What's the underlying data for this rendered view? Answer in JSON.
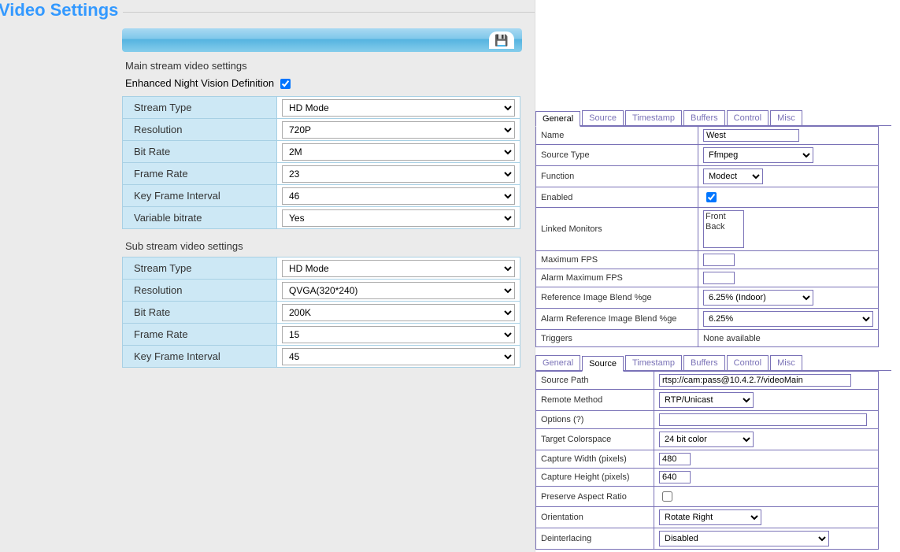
{
  "left": {
    "title": "Video Settings",
    "save_icon_name": "save-icon",
    "main_title": "Main stream video settings",
    "envd_label": "Enhanced Night Vision Definition",
    "envd_checked": true,
    "main_rows": [
      {
        "label": "Stream Type",
        "value": "HD Mode"
      },
      {
        "label": "Resolution",
        "value": "720P"
      },
      {
        "label": "Bit Rate",
        "value": "2M"
      },
      {
        "label": "Frame Rate",
        "value": "23"
      },
      {
        "label": "Key Frame Interval",
        "value": "46"
      },
      {
        "label": "Variable bitrate",
        "value": "Yes"
      }
    ],
    "sub_title": "Sub stream video settings",
    "sub_rows": [
      {
        "label": "Stream Type",
        "value": "HD Mode"
      },
      {
        "label": "Resolution",
        "value": "QVGA(320*240)"
      },
      {
        "label": "Bit Rate",
        "value": "200K"
      },
      {
        "label": "Frame Rate",
        "value": "15"
      },
      {
        "label": "Key Frame Interval",
        "value": "45"
      }
    ]
  },
  "zm": {
    "tabs": [
      "General",
      "Source",
      "Timestamp",
      "Buffers",
      "Control",
      "Misc"
    ],
    "general": {
      "active_tab": "General",
      "name_label": "Name",
      "name_value": "West",
      "source_type_label": "Source Type",
      "source_type_value": "Ffmpeg",
      "function_label": "Function",
      "function_value": "Modect",
      "enabled_label": "Enabled",
      "enabled_checked": true,
      "linked_label": "Linked Monitors",
      "linked_items": [
        "Front",
        "Back"
      ],
      "max_fps_label": "Maximum FPS",
      "max_fps_value": "",
      "alarm_max_fps_label": "Alarm Maximum FPS",
      "alarm_max_fps_value": "",
      "ref_blend_label": "Reference Image Blend %ge",
      "ref_blend_value": "6.25% (Indoor)",
      "alarm_ref_blend_label": "Alarm Reference Image Blend %ge",
      "alarm_ref_blend_value": "6.25%",
      "triggers_label": "Triggers",
      "triggers_value": "None available"
    },
    "source": {
      "active_tab": "Source",
      "path_label": "Source Path",
      "path_value": "rtsp://cam:pass@10.4.2.7/videoMain",
      "method_label": "Remote Method",
      "method_value": "RTP/Unicast",
      "options_label": "Options (?)",
      "options_value": "",
      "colorspace_label": "Target Colorspace",
      "colorspace_value": "24 bit color",
      "cap_w_label": "Capture Width (pixels)",
      "cap_w_value": "480",
      "cap_h_label": "Capture Height (pixels)",
      "cap_h_value": "640",
      "preserve_label": "Preserve Aspect Ratio",
      "preserve_checked": false,
      "orient_label": "Orientation",
      "orient_value": "Rotate Right",
      "deint_label": "Deinterlacing",
      "deint_value": "Disabled"
    }
  }
}
